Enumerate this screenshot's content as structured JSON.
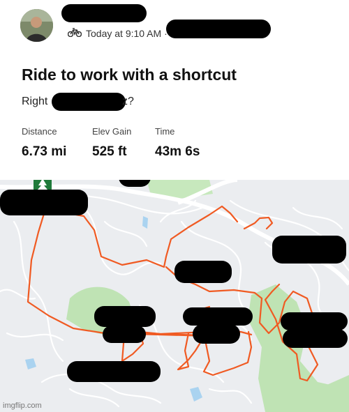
{
  "post": {
    "time_text": "Today at 9:10 AM ·",
    "title": "Ride to work with a shortcut",
    "subtitle_start": "Right",
    "subtitle_end": "z?"
  },
  "stats": [
    {
      "label": "Distance",
      "value": "6.73 mi"
    },
    {
      "label": "Elev Gain",
      "value": "525 ft"
    },
    {
      "label": "Time",
      "value": "43m 6s"
    }
  ],
  "icons": {
    "activity": "bike-icon",
    "map_marker": "tree-marker-icon"
  },
  "colors": {
    "route": "#f05a22",
    "park": "#bfe3b4",
    "water": "#aad3f0",
    "map_bg": "#ebedf0"
  },
  "watermark": "imgflip.com"
}
